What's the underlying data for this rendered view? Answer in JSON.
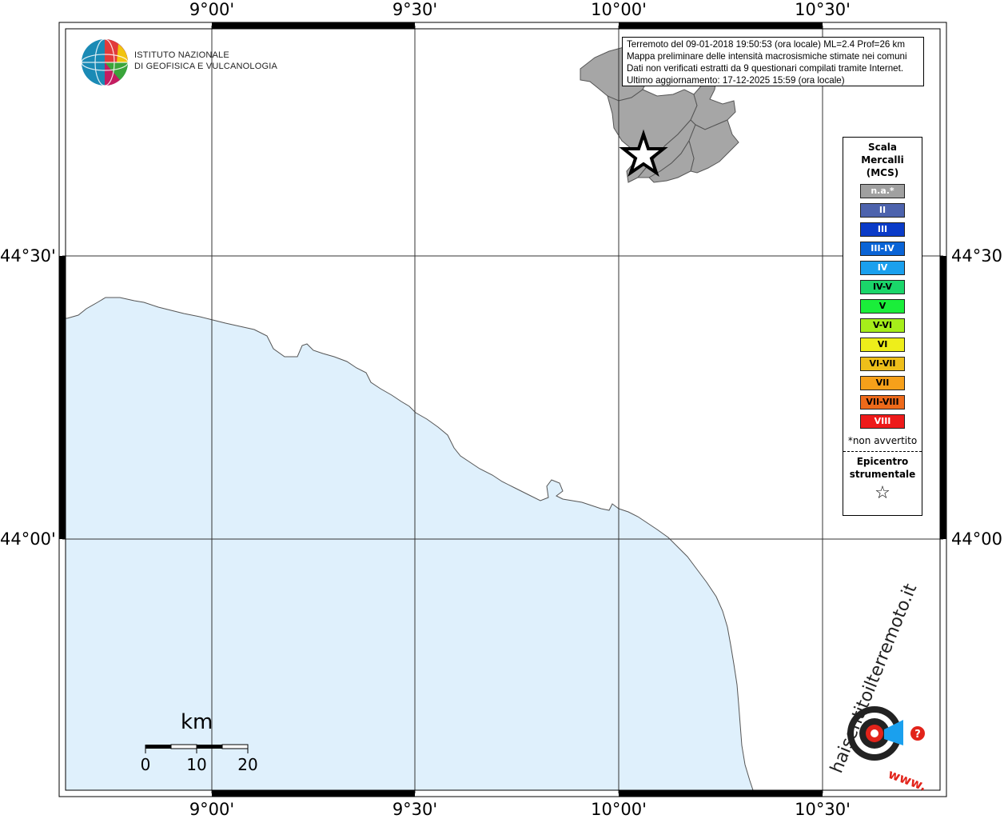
{
  "map": {
    "top_labels": [
      "9°00'",
      "9°30'",
      "10°00'",
      "10°30'"
    ],
    "bottom_labels": [
      "9°00'",
      "9°30'",
      "10°00'",
      "10°30'"
    ],
    "left_labels": [
      "44°30'",
      "44°00'"
    ],
    "right_labels": [
      "44°30'",
      "44°00'"
    ],
    "sea_color": "#dff0fc",
    "municipality_color": "#a6a6a6"
  },
  "info": {
    "line1": "Terremoto del 09-01-2018 19:50:53 (ora locale) ML=2.4 Prof=26 km",
    "line2": "Mappa preliminare delle intensità macrosismiche stimate nei comuni",
    "line3": "Dati non verificati estratti da 9 questionari compilati tramite Internet.",
    "line4": "Ultimo aggiornamento: 17-12-2025 15:59 (ora locale)"
  },
  "logo": {
    "line1": "ISTITUTO NAZIONALE",
    "line2": "DI GEOFISICA E VULCANOLOGIA"
  },
  "legend": {
    "title_line1": "Scala",
    "title_line2": "Mercalli",
    "title_line3": "(MCS)",
    "items": [
      {
        "label": "n.a.*",
        "color": "#a0a0a0",
        "text_color": "#ffffff"
      },
      {
        "label": "II",
        "color": "#4d63ad",
        "text_color": "#ffffff"
      },
      {
        "label": "III",
        "color": "#0a3bc8",
        "text_color": "#ffffff"
      },
      {
        "label": "III-IV",
        "color": "#0a64d6",
        "text_color": "#ffffff"
      },
      {
        "label": "IV",
        "color": "#1aa0ee",
        "text_color": "#ffffff"
      },
      {
        "label": "IV-V",
        "color": "#1ad66a",
        "text_color": "#000000"
      },
      {
        "label": "V",
        "color": "#1aee3a",
        "text_color": "#000000"
      },
      {
        "label": "V-VI",
        "color": "#a6ee1a",
        "text_color": "#000000"
      },
      {
        "label": "VI",
        "color": "#eeee1a",
        "text_color": "#000000"
      },
      {
        "label": "VI-VII",
        "color": "#eebf1a",
        "text_color": "#000000"
      },
      {
        "label": "VII",
        "color": "#f6a01a",
        "text_color": "#000000"
      },
      {
        "label": "VII-VIII",
        "color": "#ee6a1a",
        "text_color": "#000000"
      },
      {
        "label": "VIII",
        "color": "#ee1a1a",
        "text_color": "#ffffff"
      }
    ],
    "note": "*non avvertito",
    "epicenter_line1": "Epicentro",
    "epicenter_line2": "strumentale",
    "epicenter_symbol": "☆"
  },
  "scalebar": {
    "unit": "km",
    "ticks": [
      "0",
      "10",
      "20"
    ]
  },
  "brand": {
    "text": "haisentitoilterremoto.it",
    "url_text": "www.",
    "accent": "#e2231a"
  }
}
